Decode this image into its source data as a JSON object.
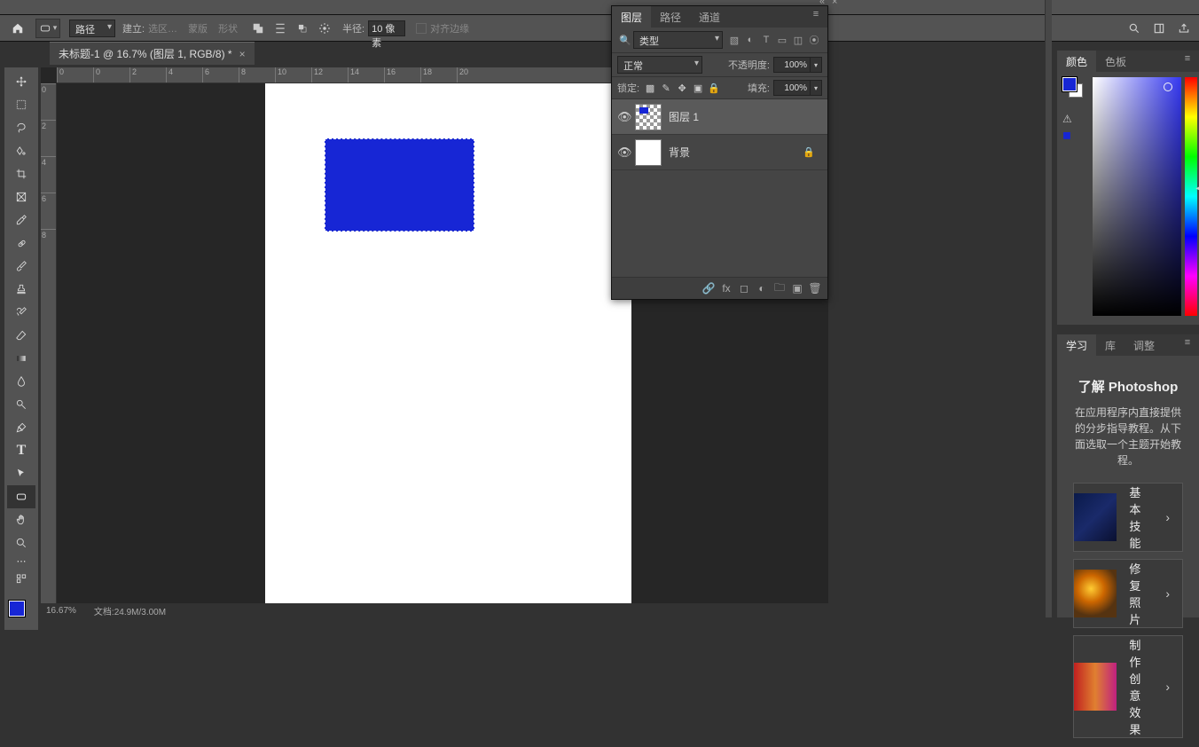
{
  "document": {
    "tab_title": "未标题-1 @ 16.7% (图层 1, RGB/8) *",
    "zoom": "16.67%",
    "file_info": "文档:24.9M/3.00M"
  },
  "options": {
    "mode": "路径",
    "make": "建立:",
    "selection": "选区…",
    "mask": "蒙版",
    "shape": "形状",
    "radius_label": "半径:",
    "radius_value": "10 像素",
    "align_edges": "对齐边缘"
  },
  "layers_panel": {
    "tabs": {
      "layers": "图层",
      "paths": "路径",
      "channels": "通道"
    },
    "filter_kind": "类型",
    "blend_mode": "正常",
    "opacity_label": "不透明度:",
    "opacity_value": "100%",
    "lock_label": "锁定:",
    "fill_label": "填充:",
    "fill_value": "100%",
    "layers": [
      {
        "name": "图层 1",
        "locked": false,
        "visible": true,
        "has_art": true
      },
      {
        "name": "背景",
        "locked": true,
        "visible": true,
        "has_art": false
      }
    ]
  },
  "color_panel": {
    "tabs": {
      "color": "颜色",
      "swatches": "色板"
    }
  },
  "learn_panel": {
    "tabs": {
      "learn": "学习",
      "libraries": "库",
      "adjust": "调整"
    },
    "title": "了解 Photoshop",
    "subtitle": "在应用程序内直接提供的分步指导教程。从下面选取一个主题开始教程。",
    "lessons": [
      {
        "title": "基本技能"
      },
      {
        "title": "修复照片"
      },
      {
        "title": "制作创意效果"
      }
    ]
  },
  "ruler": {
    "h": [
      "0",
      "0",
      "2",
      "4",
      "6",
      "8",
      "10",
      "12",
      "14",
      "16",
      "18",
      "20"
    ],
    "v": [
      "0",
      "2",
      "4",
      "6",
      "8"
    ]
  },
  "primary_color": "#1726d5"
}
